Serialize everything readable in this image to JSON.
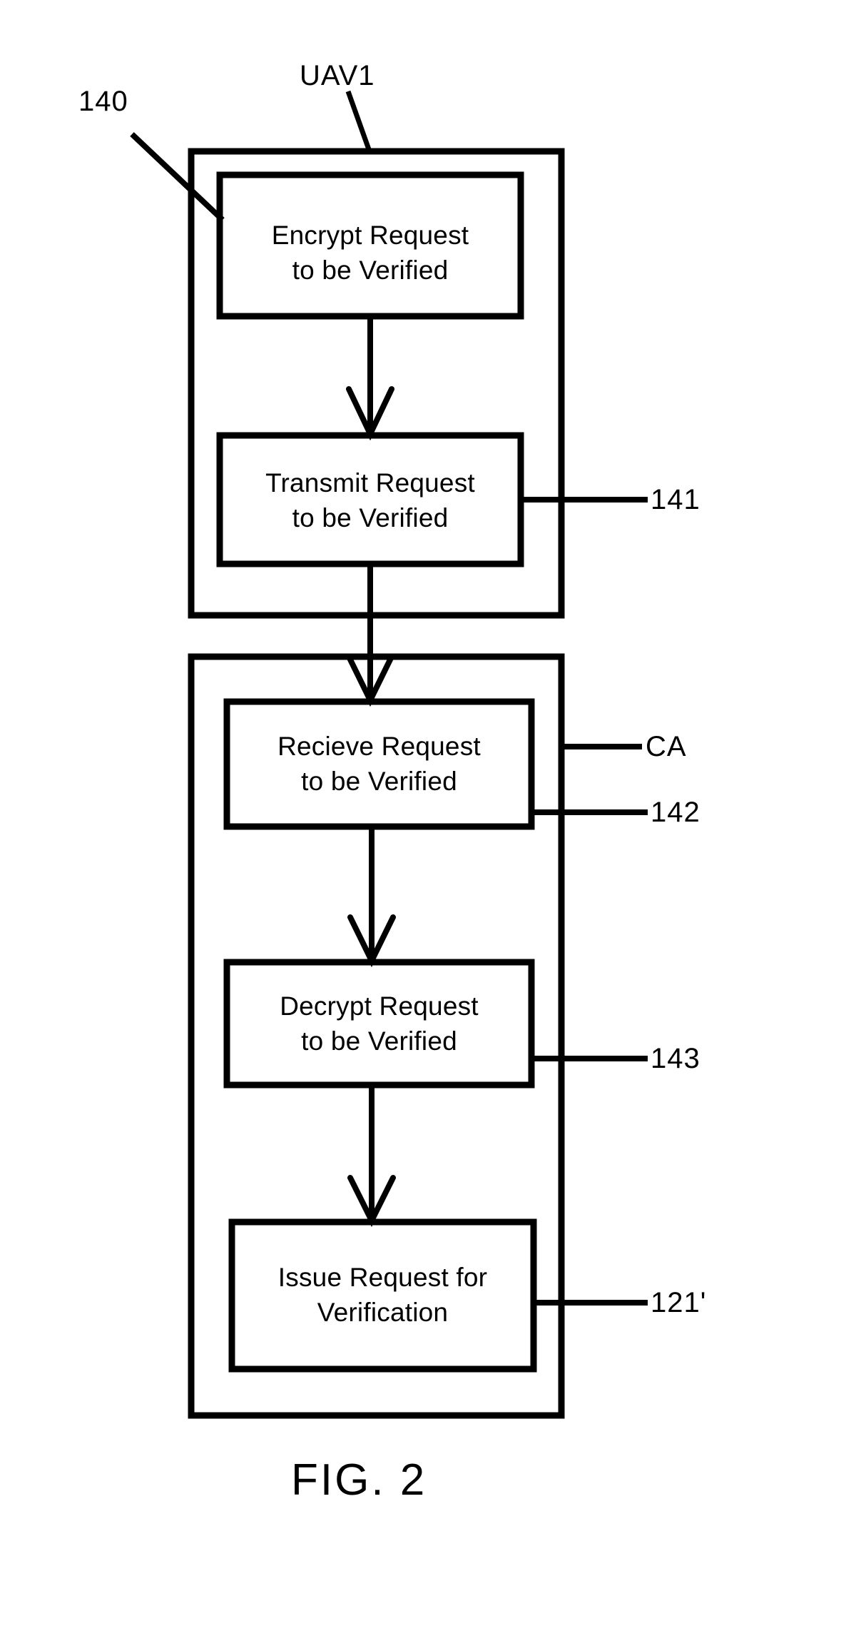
{
  "figure": {
    "caption": "FIG. 2",
    "groups": [
      {
        "id": "uav1",
        "label": "UAV1"
      },
      {
        "id": "ca",
        "label": "CA"
      }
    ],
    "reference_numerals": [
      {
        "id": "ref-140",
        "text": "140"
      },
      {
        "id": "ref-141",
        "text": "141"
      },
      {
        "id": "ref-142",
        "text": "142"
      },
      {
        "id": "ref-143",
        "text": "143"
      },
      {
        "id": "ref-121p",
        "text": "121'"
      }
    ],
    "steps": [
      {
        "id": "step-encrypt",
        "text": "Encrypt Request\nto be Verified",
        "ref": "140"
      },
      {
        "id": "step-transmit",
        "text": "Transmit Request\nto be Verified",
        "ref": "141"
      },
      {
        "id": "step-recieve",
        "text": "Recieve Request\nto be Verified",
        "ref": "142"
      },
      {
        "id": "step-decrypt",
        "text": "Decrypt Request\nto be Verified",
        "ref": "143"
      },
      {
        "id": "step-issue",
        "text": "Issue Request for\nVerification",
        "ref": "121'"
      }
    ]
  },
  "colors": {
    "ink": "#000000",
    "paper": "#ffffff"
  }
}
